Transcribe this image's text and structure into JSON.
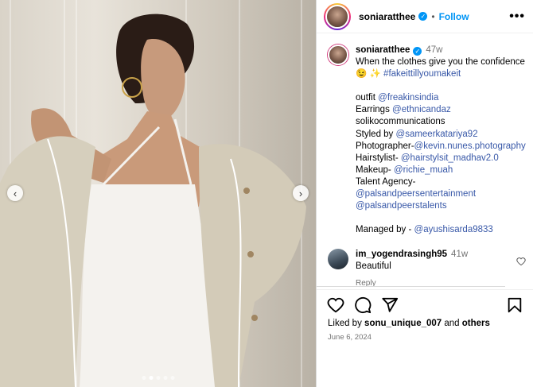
{
  "post": {
    "username": "soniaratthee",
    "follow_label": "Follow",
    "sep": "•",
    "more": "•••"
  },
  "caption": {
    "username": "soniaratthee",
    "time": "47w",
    "line1": "When the clothes give you the confidence",
    "emoji_line": "😉 ✨",
    "hashtag": "#fakeittillyoumakeit",
    "outfit_label": "outfit",
    "outfit_link": "@freakinsindia",
    "earrings_label": "Earrings",
    "earrings_link": "@ethnicandaz",
    "solik": "solikocommunications",
    "styled_label": "Styled by",
    "styled_link": "@sameerkatariya92",
    "photographer_label": "Photographer-",
    "photographer_link": "@kevin.nunes.photography",
    "hair_label": "Hairstylist-",
    "hair_link": "@hairstylsit_madhav2.0",
    "makeup_label": "Makeup-",
    "makeup_link": "@richie_muah",
    "agency_label": "Talent Agency-",
    "agency_link1": "@palsandpeersentertainment",
    "agency_link2": "@palsandpeerstalents",
    "managed_label": "Managed by -",
    "managed_link": "@ayushisarda9833"
  },
  "comment": {
    "username": "im_yogendrasingh95",
    "time": "41w",
    "text": "Beautiful",
    "reply": "Reply"
  },
  "likes": {
    "prefix": "Liked by",
    "user": "sonu_unique_007",
    "and": "and",
    "others": "others"
  },
  "date": "June 6, 2024",
  "carousel": {
    "prev": "‹",
    "next": "›",
    "dot_count": 5,
    "active_index": 1
  },
  "colors": {
    "link": "#3858a8",
    "follow": "#0095f6",
    "muted": "#737373"
  },
  "icons": [
    "heart-icon",
    "comment-icon",
    "share-icon",
    "bookmark-icon",
    "verified-icon",
    "more-icon"
  ]
}
